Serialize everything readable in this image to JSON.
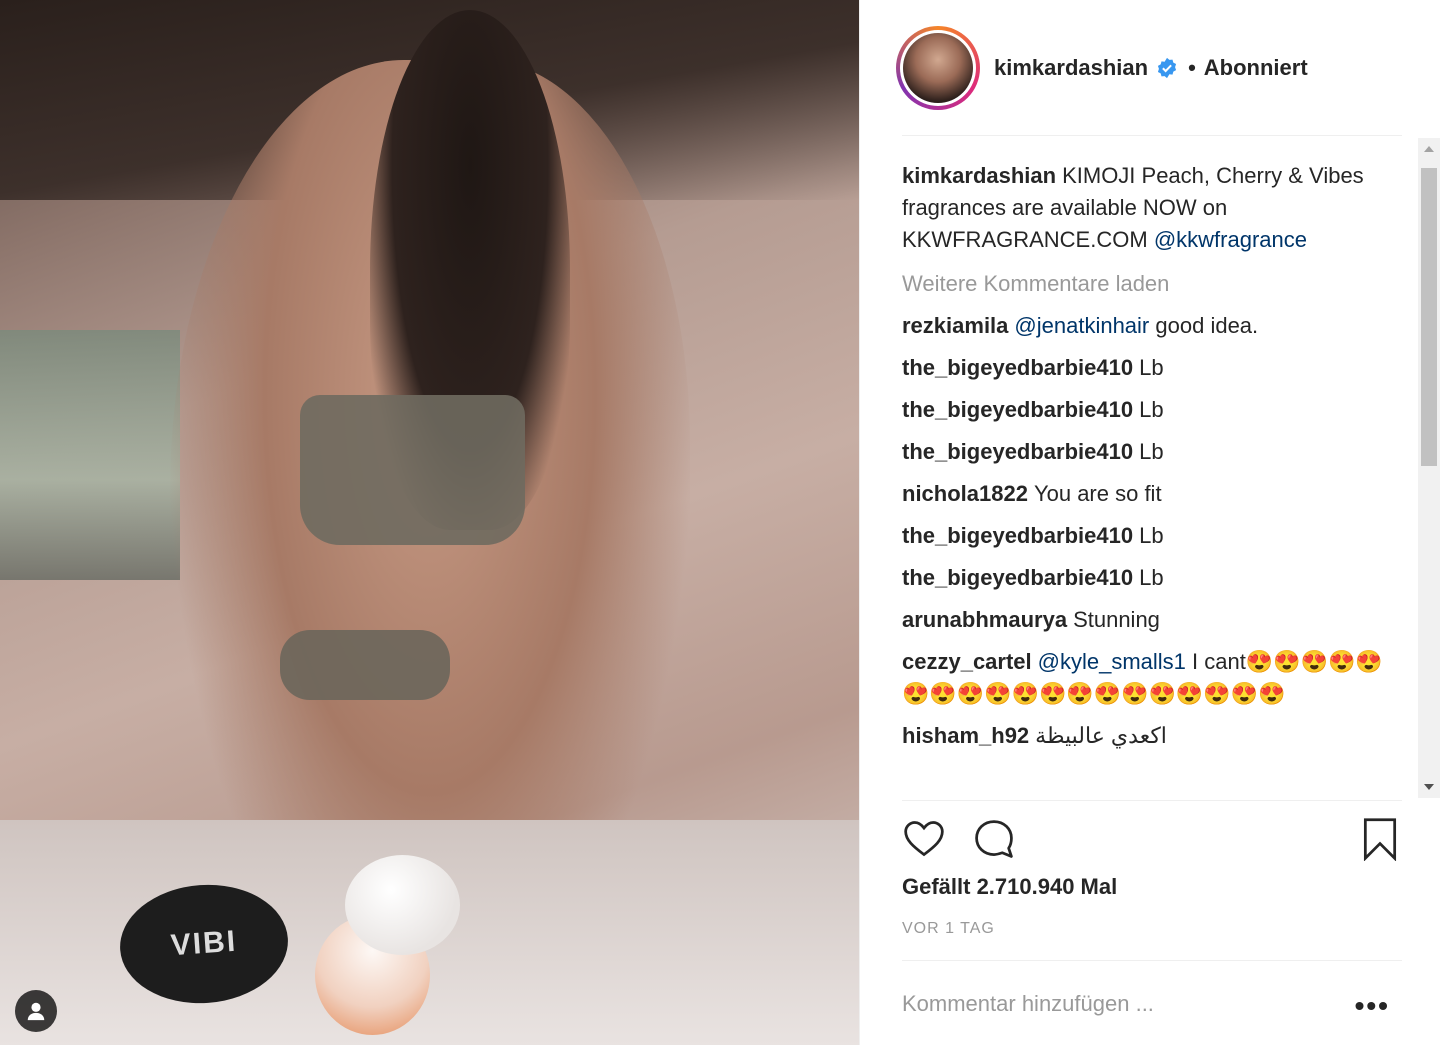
{
  "header": {
    "username": "kimkardashian",
    "follow_status": "Abonniert",
    "dot": "•"
  },
  "photo": {
    "bottle_text": "VIBI"
  },
  "caption": {
    "username": "kimkardashian",
    "text": "KIMOJI Peach, Cherry & Vibes fragrances are available NOW on KKWFRAGRANCE.COM",
    "mention": "@kkwfragrance"
  },
  "load_more": "Weitere Kommentare laden",
  "comments": [
    {
      "user": "rezkiamila",
      "mention": "@jenatkinhair",
      "text": "good idea."
    },
    {
      "user": "the_bigeyedbarbie410",
      "mention": "",
      "text": "Lb"
    },
    {
      "user": "the_bigeyedbarbie410",
      "mention": "",
      "text": "Lb"
    },
    {
      "user": "the_bigeyedbarbie410",
      "mention": "",
      "text": "Lb"
    },
    {
      "user": "nichola1822",
      "mention": "",
      "text": "You are so fit"
    },
    {
      "user": "the_bigeyedbarbie410",
      "mention": "",
      "text": "Lb"
    },
    {
      "user": "the_bigeyedbarbie410",
      "mention": "",
      "text": "Lb"
    },
    {
      "user": "arunabhmaurya",
      "mention": "",
      "text": "Stunning"
    },
    {
      "user": "cezzy_cartel",
      "mention": "@kyle_smalls1",
      "text": "I cant😍😍😍😍😍😍😍😍😍😍😍😍😍😍😍😍😍😍😍"
    },
    {
      "user": "hisham_h92",
      "mention": "",
      "text": "اكعدي عالبيظة"
    }
  ],
  "likes": "Gefällt 2.710.940 Mal",
  "time": "VOR 1 TAG",
  "add_comment_placeholder": "Kommentar hinzufügen ...",
  "more_options": "•••",
  "colors": {
    "link": "#003569",
    "verified": "#3897f0",
    "muted": "#999999",
    "text": "#262626"
  }
}
